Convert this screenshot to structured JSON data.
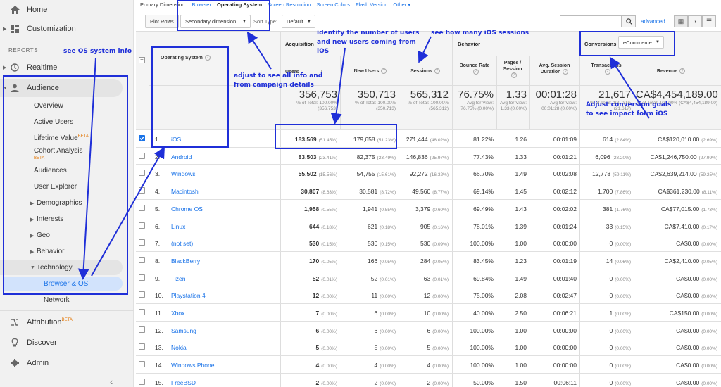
{
  "sidebar": {
    "home": "Home",
    "customization": "Customization",
    "reports_header": "REPORTS",
    "realtime": "Realtime",
    "audience": "Audience",
    "audience_items": [
      "Overview",
      "Active Users",
      "Lifetime Value",
      "Cohort Analysis",
      "Audiences",
      "User Explorer"
    ],
    "lifetime_beta": "BETA",
    "cohort_beta": "BETA",
    "audience_groups": [
      "Demographics",
      "Interests",
      "Geo",
      "Behavior",
      "Technology"
    ],
    "tech_items": [
      "Browser & OS",
      "Network"
    ],
    "attribution": "Attribution",
    "attribution_beta": "BETA",
    "discover": "Discover",
    "admin": "Admin",
    "collapse": "‹"
  },
  "topbar": {
    "primary_label": "Primary Dimension:",
    "tabs": [
      "Browser",
      "Operating System",
      "Screen Resolution",
      "Screen Colors",
      "Flash Version",
      "Other ▾"
    ]
  },
  "toolbar": {
    "plot_rows": "Plot Rows",
    "secondary": "Secondary dimension",
    "sort_label": "Sort Type:",
    "sort_value": "Default",
    "advanced": "advanced"
  },
  "table": {
    "dim_header": "Operating System",
    "group_acq": "Acquisition",
    "group_beh": "Behavior",
    "group_conv": "Conversions",
    "conv_select": "eCommerce",
    "columns": [
      "Users",
      "New Users",
      "Sessions",
      "Bounce Rate",
      "Pages / Session",
      "Avg. Session Duration",
      "Transactions",
      "Revenue"
    ],
    "totals": [
      {
        "big": "356,753",
        "sub": "% of Total: 100.00% (356,753)"
      },
      {
        "big": "350,713",
        "sub": "% of Total: 100.00% (350,713)"
      },
      {
        "big": "565,312",
        "sub": "% of Total: 100.00% (565,312)"
      },
      {
        "big": "76.75%",
        "sub": "Avg for View: 76.75% (0.00%)"
      },
      {
        "big": "1.33",
        "sub": "Avg for View: 1.33 (0.00%)"
      },
      {
        "big": "00:01:28",
        "sub": "Avg for View: 00:01:28 (0.00%)"
      },
      {
        "big": "21,617",
        "sub": "% of Total: 100.00% (21,617)"
      },
      {
        "big": "CA$4,454,189.00",
        "sub": "% of Total: 100.00% (CA$4,454,189.00)"
      }
    ],
    "rows": [
      {
        "n": "1.",
        "os": "iOS",
        "checked": true,
        "users": "183,569",
        "users_p": "(51.45%)",
        "new": "179,658",
        "new_p": "(51.23%)",
        "sess": "271,444",
        "sess_p": "(48.02%)",
        "bounce": "81.22%",
        "pps": "1.26",
        "dur": "00:01:09",
        "tx": "614",
        "tx_p": "(2.84%)",
        "rev": "CA$120,010.00",
        "rev_p": "(2.69%)"
      },
      {
        "n": "2.",
        "os": "Android",
        "checked": false,
        "users": "83,503",
        "users_p": "(23.41%)",
        "new": "82,375",
        "new_p": "(23.49%)",
        "sess": "146,836",
        "sess_p": "(25.97%)",
        "bounce": "77.43%",
        "pps": "1.33",
        "dur": "00:01:21",
        "tx": "6,096",
        "tx_p": "(28.20%)",
        "rev": "CA$1,246,750.00",
        "rev_p": "(27.99%)"
      },
      {
        "n": "3.",
        "os": "Windows",
        "checked": false,
        "users": "55,502",
        "users_p": "(15.56%)",
        "new": "54,755",
        "new_p": "(15.61%)",
        "sess": "92,272",
        "sess_p": "(16.32%)",
        "bounce": "66.70%",
        "pps": "1.49",
        "dur": "00:02:08",
        "tx": "12,778",
        "tx_p": "(59.11%)",
        "rev": "CA$2,639,214.00",
        "rev_p": "(59.25%)"
      },
      {
        "n": "4.",
        "os": "Macintosh",
        "checked": false,
        "users": "30,807",
        "users_p": "(8.63%)",
        "new": "30,581",
        "new_p": "(8.72%)",
        "sess": "49,560",
        "sess_p": "(8.77%)",
        "bounce": "69.14%",
        "pps": "1.45",
        "dur": "00:02:12",
        "tx": "1,700",
        "tx_p": "(7.86%)",
        "rev": "CA$361,230.00",
        "rev_p": "(8.11%)"
      },
      {
        "n": "5.",
        "os": "Chrome OS",
        "checked": false,
        "users": "1,958",
        "users_p": "(0.55%)",
        "new": "1,941",
        "new_p": "(0.55%)",
        "sess": "3,379",
        "sess_p": "(0.60%)",
        "bounce": "69.49%",
        "pps": "1.43",
        "dur": "00:02:02",
        "tx": "381",
        "tx_p": "(1.76%)",
        "rev": "CA$77,015.00",
        "rev_p": "(1.73%)"
      },
      {
        "n": "6.",
        "os": "Linux",
        "checked": false,
        "users": "644",
        "users_p": "(0.18%)",
        "new": "621",
        "new_p": "(0.18%)",
        "sess": "905",
        "sess_p": "(0.16%)",
        "bounce": "78.01%",
        "pps": "1.39",
        "dur": "00:01:24",
        "tx": "33",
        "tx_p": "(0.15%)",
        "rev": "CA$7,410.00",
        "rev_p": "(0.17%)"
      },
      {
        "n": "7.",
        "os": "(not set)",
        "checked": false,
        "users": "530",
        "users_p": "(0.15%)",
        "new": "530",
        "new_p": "(0.15%)",
        "sess": "530",
        "sess_p": "(0.09%)",
        "bounce": "100.00%",
        "pps": "1.00",
        "dur": "00:00:00",
        "tx": "0",
        "tx_p": "(0.00%)",
        "rev": "CA$0.00",
        "rev_p": "(0.00%)"
      },
      {
        "n": "8.",
        "os": "BlackBerry",
        "checked": false,
        "users": "170",
        "users_p": "(0.05%)",
        "new": "166",
        "new_p": "(0.05%)",
        "sess": "284",
        "sess_p": "(0.05%)",
        "bounce": "83.45%",
        "pps": "1.23",
        "dur": "00:01:19",
        "tx": "14",
        "tx_p": "(0.06%)",
        "rev": "CA$2,410.00",
        "rev_p": "(0.05%)"
      },
      {
        "n": "9.",
        "os": "Tizen",
        "checked": false,
        "users": "52",
        "users_p": "(0.01%)",
        "new": "52",
        "new_p": "(0.01%)",
        "sess": "63",
        "sess_p": "(0.01%)",
        "bounce": "69.84%",
        "pps": "1.49",
        "dur": "00:01:40",
        "tx": "0",
        "tx_p": "(0.00%)",
        "rev": "CA$0.00",
        "rev_p": "(0.00%)"
      },
      {
        "n": "10.",
        "os": "Playstation 4",
        "checked": false,
        "users": "12",
        "users_p": "(0.00%)",
        "new": "11",
        "new_p": "(0.00%)",
        "sess": "12",
        "sess_p": "(0.00%)",
        "bounce": "75.00%",
        "pps": "2.08",
        "dur": "00:02:47",
        "tx": "0",
        "tx_p": "(0.00%)",
        "rev": "CA$0.00",
        "rev_p": "(0.00%)"
      },
      {
        "n": "11.",
        "os": "Xbox",
        "checked": false,
        "users": "7",
        "users_p": "(0.00%)",
        "new": "6",
        "new_p": "(0.00%)",
        "sess": "10",
        "sess_p": "(0.00%)",
        "bounce": "40.00%",
        "pps": "2.50",
        "dur": "00:06:21",
        "tx": "1",
        "tx_p": "(0.00%)",
        "rev": "CA$150.00",
        "rev_p": "(0.00%)"
      },
      {
        "n": "12.",
        "os": "Samsung",
        "checked": false,
        "users": "6",
        "users_p": "(0.00%)",
        "new": "6",
        "new_p": "(0.00%)",
        "sess": "6",
        "sess_p": "(0.00%)",
        "bounce": "100.00%",
        "pps": "1.00",
        "dur": "00:00:00",
        "tx": "0",
        "tx_p": "(0.00%)",
        "rev": "CA$0.00",
        "rev_p": "(0.00%)"
      },
      {
        "n": "13.",
        "os": "Nokia",
        "checked": false,
        "users": "5",
        "users_p": "(0.00%)",
        "new": "5",
        "new_p": "(0.00%)",
        "sess": "5",
        "sess_p": "(0.00%)",
        "bounce": "100.00%",
        "pps": "1.00",
        "dur": "00:00:00",
        "tx": "0",
        "tx_p": "(0.00%)",
        "rev": "CA$0.00",
        "rev_p": "(0.00%)"
      },
      {
        "n": "14.",
        "os": "Windows Phone",
        "checked": false,
        "users": "4",
        "users_p": "(0.00%)",
        "new": "4",
        "new_p": "(0.00%)",
        "sess": "4",
        "sess_p": "(0.00%)",
        "bounce": "100.00%",
        "pps": "1.00",
        "dur": "00:00:00",
        "tx": "0",
        "tx_p": "(0.00%)",
        "rev": "CA$0.00",
        "rev_p": "(0.00%)"
      },
      {
        "n": "15.",
        "os": "FreeBSD",
        "checked": false,
        "users": "2",
        "users_p": "(0.00%)",
        "new": "2",
        "new_p": "(0.00%)",
        "sess": "2",
        "sess_p": "(0.00%)",
        "bounce": "50.00%",
        "pps": "1.50",
        "dur": "00:06:11",
        "tx": "0",
        "tx_p": "(0.00%)",
        "rev": "CA$0.00",
        "rev_p": "(0.00%)"
      }
    ]
  },
  "annotations": {
    "os_info": "see OS system info",
    "adjust": "adjust to see all info  and from campaign details",
    "identify": "identify the number of users and new users coming from iOS",
    "sessions": "see how many iOS sessions",
    "conversion": "Adjust conversion goals to see impact form iOS"
  },
  "colors": {
    "accent": "#1a73e8",
    "annotation": "#1f2fd8",
    "sidebar_bg": "#f1f1f1"
  }
}
